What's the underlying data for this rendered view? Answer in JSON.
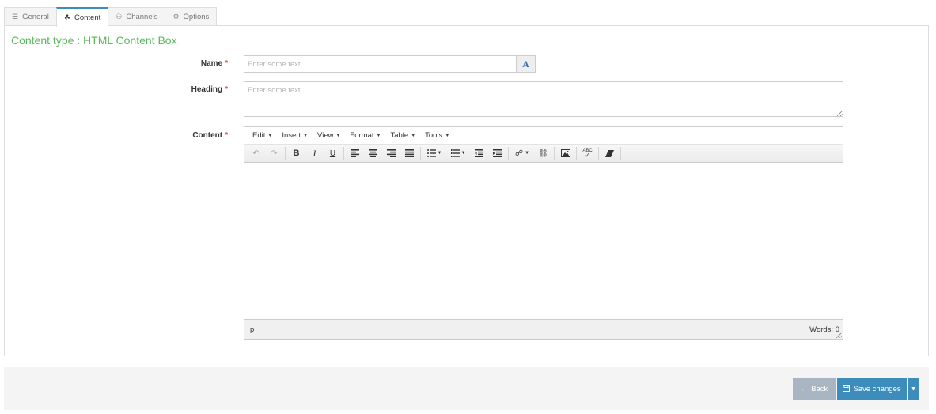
{
  "tabs": [
    {
      "label": "General",
      "icon": "sliders-icon",
      "glyph": "☰"
    },
    {
      "label": "Content",
      "icon": "shapes-icon",
      "glyph": "☘"
    },
    {
      "label": "Channels",
      "icon": "sitemap-icon",
      "glyph": "⚇"
    },
    {
      "label": "Options",
      "icon": "gears-icon",
      "glyph": "⚙"
    }
  ],
  "active_tab": "Content",
  "content_type": "Content type : HTML Content Box",
  "form": {
    "name_label": "Name",
    "name_placeholder": "Enter some text",
    "heading_label": "Heading",
    "heading_placeholder": "Enter some text",
    "content_label": "Content",
    "required_mark": "*",
    "translate_glyph": "A"
  },
  "editor": {
    "menus": [
      "Edit",
      "Insert",
      "View",
      "Format",
      "Table",
      "Tools"
    ],
    "status_path": "p",
    "word_count": "Words: 0"
  },
  "footer": {
    "back_label": "Back",
    "save_label": "Save changes"
  },
  "colors": {
    "accent": "#3c8dbc",
    "content_type": "#5cb85c",
    "required": "#d9534f",
    "back_button": "#a8b5c2"
  }
}
